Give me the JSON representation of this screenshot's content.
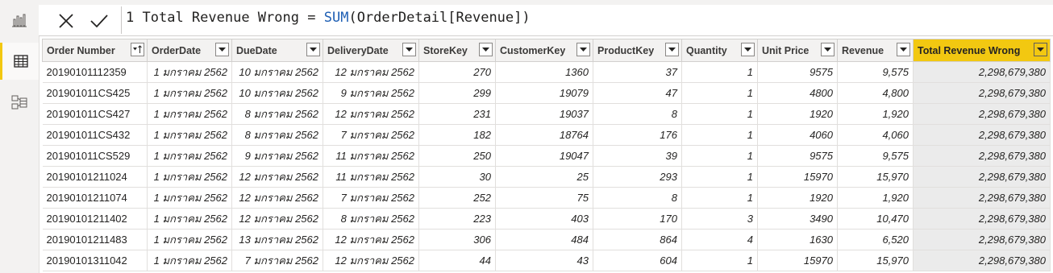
{
  "formula": {
    "line_number": "1",
    "measure_name": "Total Revenue Wrong",
    "equals": "=",
    "function": "SUM",
    "argument": "OrderDetail[Revenue]"
  },
  "table": {
    "columns": [
      {
        "label": "Order Number",
        "sort": "ascending"
      },
      {
        "label": "OrderDate"
      },
      {
        "label": "DueDate"
      },
      {
        "label": "DeliveryDate"
      },
      {
        "label": "StoreKey"
      },
      {
        "label": "CustomerKey"
      },
      {
        "label": "ProductKey"
      },
      {
        "label": "Quantity"
      },
      {
        "label": "Unit Price"
      },
      {
        "label": "Revenue"
      },
      {
        "label": "Total Revenue Wrong",
        "highlighted": true
      }
    ],
    "rows": [
      [
        "20190101112359",
        "1 มกราคม 2562",
        "10 มกราคม 2562",
        "12 มกราคม 2562",
        "270",
        "1360",
        "37",
        "1",
        "9575",
        "9,575",
        "2,298,679,380"
      ],
      [
        "201901011CS425",
        "1 มกราคม 2562",
        "10 มกราคม 2562",
        "9 มกราคม 2562",
        "299",
        "19079",
        "47",
        "1",
        "4800",
        "4,800",
        "2,298,679,380"
      ],
      [
        "201901011CS427",
        "1 มกราคม 2562",
        "8 มกราคม 2562",
        "12 มกราคม 2562",
        "231",
        "19037",
        "8",
        "1",
        "1920",
        "1,920",
        "2,298,679,380"
      ],
      [
        "201901011CS432",
        "1 มกราคม 2562",
        "8 มกราคม 2562",
        "7 มกราคม 2562",
        "182",
        "18764",
        "176",
        "1",
        "4060",
        "4,060",
        "2,298,679,380"
      ],
      [
        "201901011CS529",
        "1 มกราคม 2562",
        "9 มกราคม 2562",
        "11 มกราคม 2562",
        "250",
        "19047",
        "39",
        "1",
        "9575",
        "9,575",
        "2,298,679,380"
      ],
      [
        "20190101211024",
        "1 มกราคม 2562",
        "12 มกราคม 2562",
        "11 มกราคม 2562",
        "30",
        "25",
        "293",
        "1",
        "15970",
        "15,970",
        "2,298,679,380"
      ],
      [
        "20190101211074",
        "1 มกราคม 2562",
        "12 มกราคม 2562",
        "7 มกราคม 2562",
        "252",
        "75",
        "8",
        "1",
        "1920",
        "1,920",
        "2,298,679,380"
      ],
      [
        "20190101211402",
        "1 มกราคม 2562",
        "12 มกราคม 2562",
        "8 มกราคม 2562",
        "223",
        "403",
        "170",
        "3",
        "3490",
        "10,470",
        "2,298,679,380"
      ],
      [
        "20190101211483",
        "1 มกราคม 2562",
        "13 มกราคม 2562",
        "12 มกราคม 2562",
        "306",
        "484",
        "864",
        "4",
        "1630",
        "6,520",
        "2,298,679,380"
      ],
      [
        "20190101311042",
        "1 มกราคม 2562",
        "7 มกราคม 2562",
        "12 มกราคม 2562",
        "44",
        "43",
        "604",
        "1",
        "15970",
        "15,970",
        "2,298,679,380"
      ]
    ]
  },
  "icons": {
    "report_view": "bar-chart-icon",
    "data_view": "table-grid-icon",
    "model_view": "model-diagram-icon",
    "cancel": "close-icon",
    "commit": "checkmark-icon"
  },
  "colors": {
    "accent": "#f2c811",
    "function": "#1e5fb4"
  }
}
